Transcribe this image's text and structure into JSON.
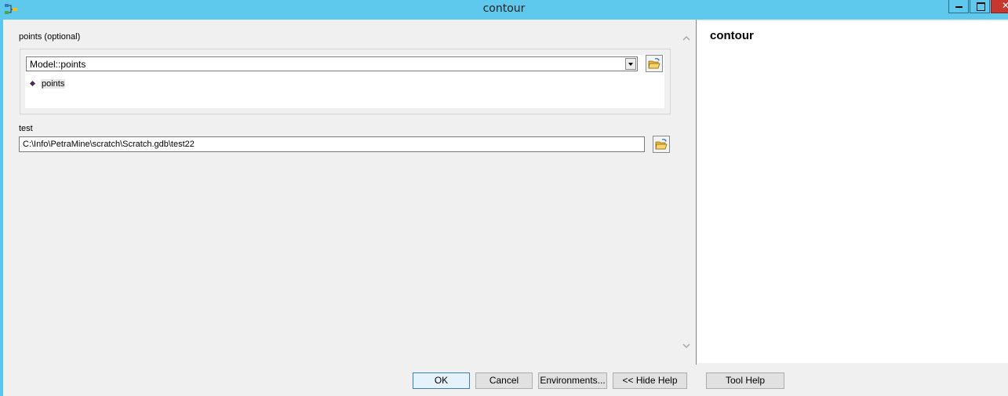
{
  "window": {
    "title": "contour",
    "controls": {
      "minimize": "minimize",
      "maximize": "maximize",
      "close": "✕"
    },
    "app_icon": "model-builder-icon"
  },
  "params": {
    "points_label": "points (optional)",
    "points_combo_value": "Model::points",
    "points_list": [
      "points"
    ],
    "test_label": "test",
    "test_value": "C:\\Info\\PetraMine\\scratch\\Scratch.gdb\\test22",
    "browse_icon": "open-folder-icon"
  },
  "help": {
    "title": "contour"
  },
  "buttons": {
    "ok": "OK",
    "cancel": "Cancel",
    "environments": "Environments...",
    "hide_help": "<< Hide Help",
    "tool_help": "Tool Help"
  },
  "colors": {
    "titlebar": "#5ec8ed",
    "close": "#c7372f",
    "panel": "#f0f0f0",
    "default_button_border": "#3c7fb1"
  }
}
